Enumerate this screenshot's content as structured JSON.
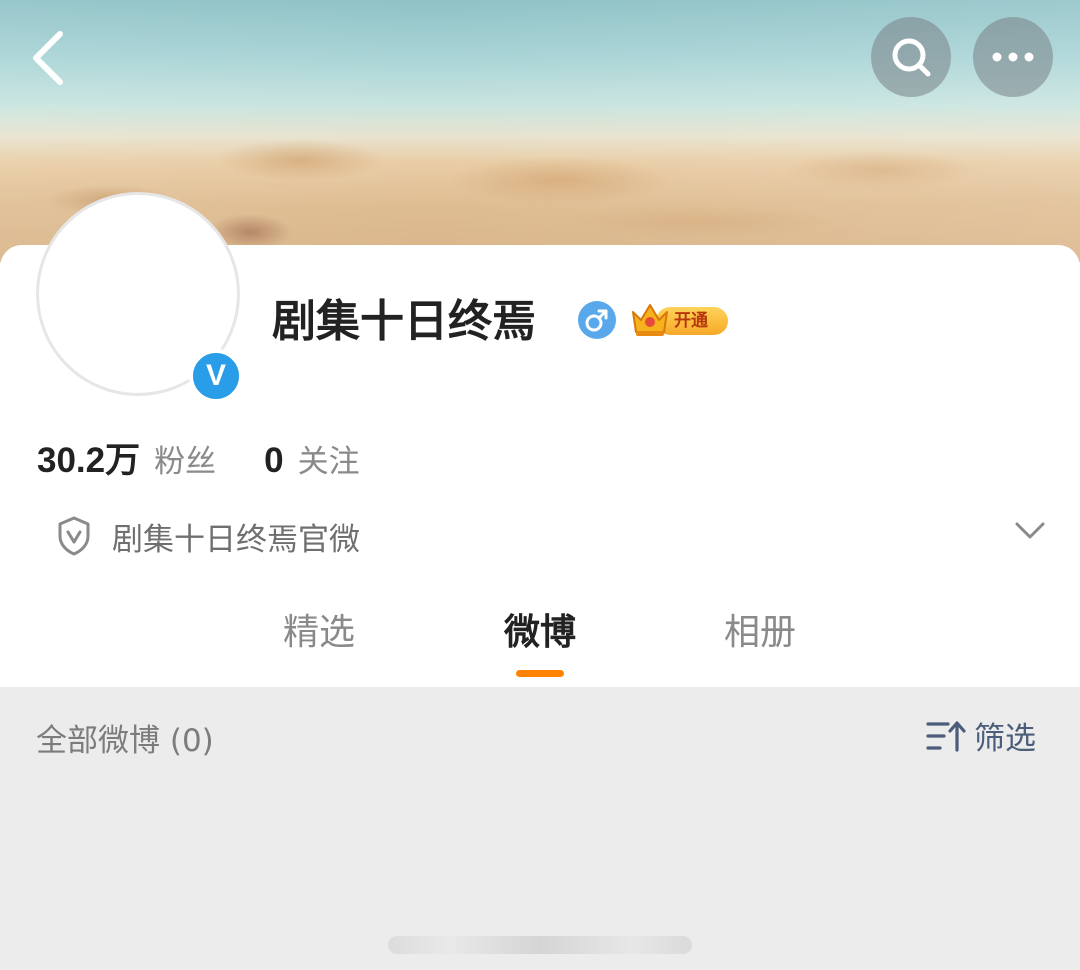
{
  "header": {
    "back_icon": "chevron-left-icon",
    "search_icon": "search-icon",
    "more_icon": "more-dots-icon",
    "banner_theme": "beach sand and sea"
  },
  "profile": {
    "name": "剧集十日终焉",
    "gender_icon": "male-icon",
    "verified_icon": "verified-v-icon",
    "vip_badge_label": "开通",
    "vip_icon": "crown-icon"
  },
  "stats": {
    "followers_count": "30.2万",
    "followers_label": "粉丝",
    "following_count": "0",
    "following_label": "关注"
  },
  "certification": {
    "icon": "shield-v-icon",
    "text": "剧集十日终焉官微",
    "expand_icon": "chevron-down-icon"
  },
  "tabs": [
    {
      "label": "精选",
      "active": false
    },
    {
      "label": "微博",
      "active": true
    },
    {
      "label": "相册",
      "active": false
    }
  ],
  "feed": {
    "title": "全部微博 (0)",
    "filter_label": "筛选",
    "filter_icon": "sort-filter-icon"
  },
  "colors": {
    "accent": "#ff8200",
    "verified_blue": "#2a9de8",
    "filter_blue": "#4a5d7a",
    "background": "#ececec"
  }
}
